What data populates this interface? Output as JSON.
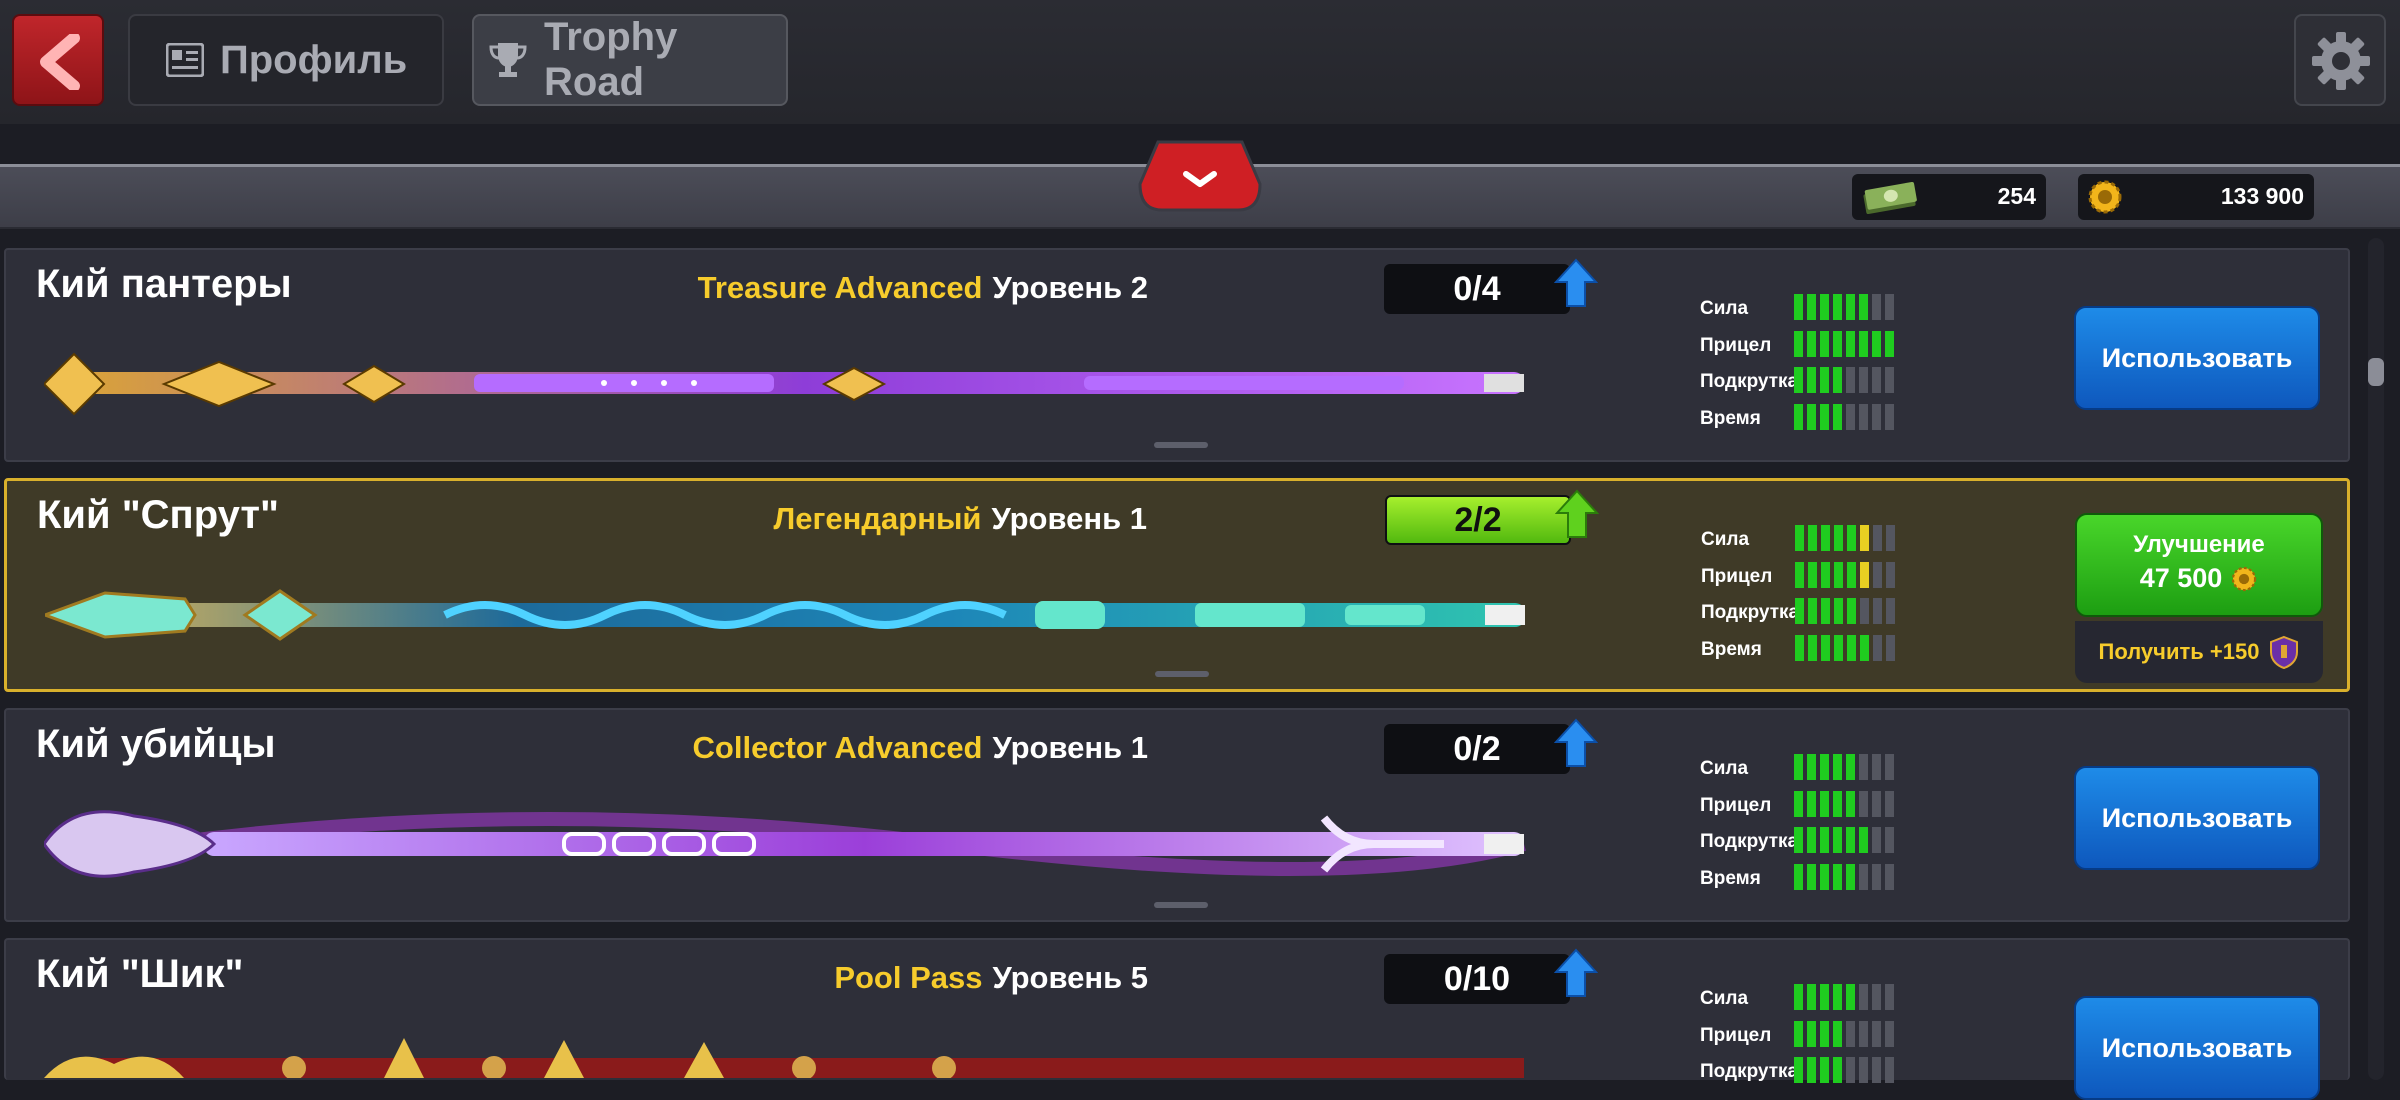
{
  "topbar": {
    "back_icon": "chevron-left-icon",
    "tab_profile": "Профиль",
    "tab_profile_icon": "id-card-icon",
    "tab_trophy": "Trophy Road",
    "tab_trophy_icon": "trophy-icon",
    "settings_icon": "gear-icon"
  },
  "currency": {
    "cash": "254",
    "cash_icon": "cash-stack-icon",
    "coins": "133 900",
    "coins_icon": "coin-icon"
  },
  "cues": [
    {
      "name": "Кий пантеры",
      "rarity": "Treasure Advanced",
      "level": "Уровень 2",
      "progress": "0/4",
      "progress_fraction": 0,
      "stats": [
        {
          "label": "Сила",
          "green": 6,
          "yellow": 0
        },
        {
          "label": "Прицел",
          "green": 8,
          "yellow": 0
        },
        {
          "label": "Подкрутка",
          "green": 4,
          "yellow": 0
        },
        {
          "label": "Время",
          "green": 4,
          "yellow": 0
        }
      ],
      "action": "Использовать"
    },
    {
      "name": "Кий \"Спрут\"",
      "rarity": "Легендарный",
      "level": "Уровень 1",
      "progress": "2/2",
      "progress_fraction": 1,
      "stats": [
        {
          "label": "Сила",
          "green": 5,
          "yellow": 1
        },
        {
          "label": "Прицел",
          "green": 5,
          "yellow": 1
        },
        {
          "label": "Подкрутка",
          "green": 5,
          "yellow": 0
        },
        {
          "label": "Время",
          "green": 6,
          "yellow": 0
        }
      ],
      "upgrade_label": "Улучшение",
      "upgrade_price": "47 500",
      "bonus": "Получить +150"
    },
    {
      "name": "Кий убийцы",
      "rarity": "Collector Advanced",
      "level": "Уровень 1",
      "progress": "0/2",
      "progress_fraction": 0,
      "stats": [
        {
          "label": "Сила",
          "green": 5,
          "yellow": 0
        },
        {
          "label": "Прицел",
          "green": 5,
          "yellow": 0
        },
        {
          "label": "Подкрутка",
          "green": 6,
          "yellow": 0
        },
        {
          "label": "Время",
          "green": 5,
          "yellow": 0
        }
      ],
      "action": "Использовать"
    },
    {
      "name": "Кий \"Шик\"",
      "rarity": "Pool Pass",
      "level": "Уровень 5",
      "progress": "0/10",
      "progress_fraction": 0,
      "stats": [
        {
          "label": "Сила",
          "green": 5,
          "yellow": 0
        },
        {
          "label": "Прицел",
          "green": 4,
          "yellow": 0
        },
        {
          "label": "Подкрутка",
          "green": 4,
          "yellow": 0
        }
      ],
      "action": "Использовать"
    }
  ]
}
